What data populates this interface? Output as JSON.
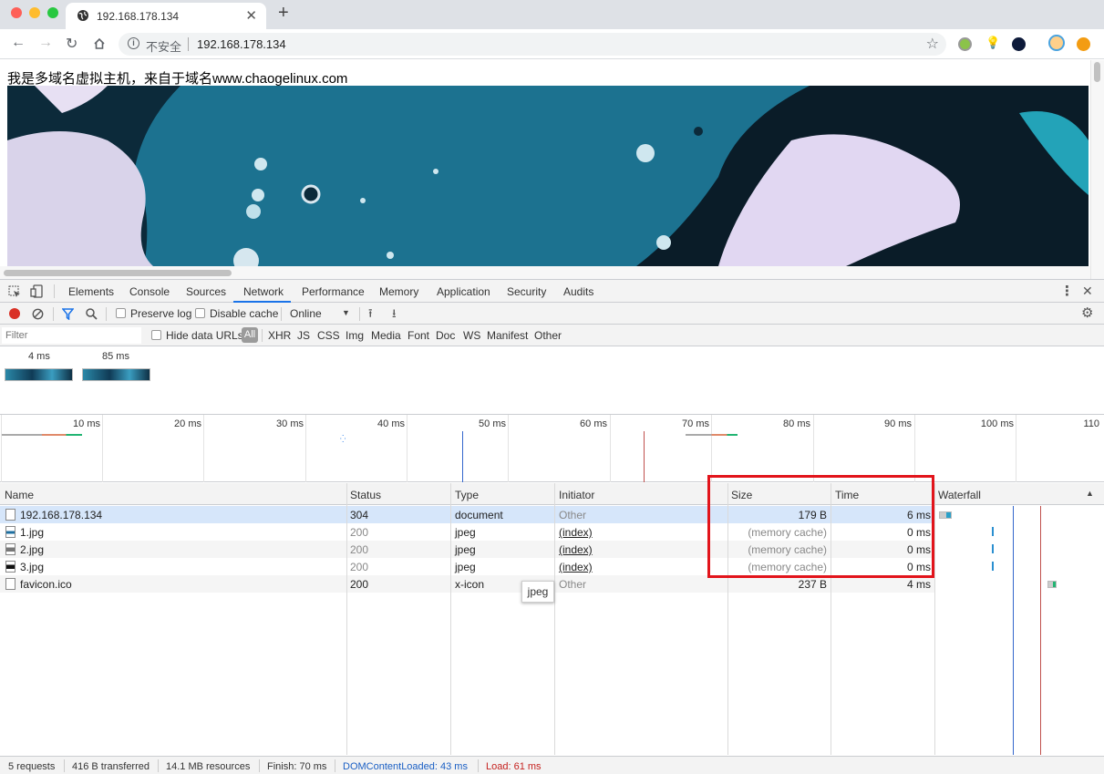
{
  "browser": {
    "tab_title": "192.168.178.134",
    "insecure_label": "不安全",
    "url": "192.168.178.134"
  },
  "page": {
    "text": "我是多域名虚拟主机，来自于域名www.chaogelinux.com"
  },
  "devtools": {
    "tabs": [
      "Elements",
      "Console",
      "Sources",
      "Network",
      "Performance",
      "Memory",
      "Application",
      "Security",
      "Audits"
    ],
    "active_tab": "Network",
    "toolbar": {
      "preserve_log": "Preserve log",
      "disable_cache": "Disable cache",
      "throttle": "Online"
    },
    "filter": {
      "placeholder": "Filter",
      "hide_data_urls": "Hide data URLs",
      "types": [
        "All",
        "XHR",
        "JS",
        "CSS",
        "Img",
        "Media",
        "Font",
        "Doc",
        "WS",
        "Manifest",
        "Other"
      ]
    },
    "screenshots": [
      "4 ms",
      "85 ms"
    ],
    "overview_ticks": [
      "10 ms",
      "20 ms",
      "30 ms",
      "40 ms",
      "50 ms",
      "60 ms",
      "70 ms",
      "80 ms",
      "90 ms",
      "100 ms",
      "110"
    ],
    "columns": [
      "Name",
      "Status",
      "Type",
      "Initiator",
      "Size",
      "Time",
      "Waterfall"
    ],
    "rows": [
      {
        "name": "192.168.178.134",
        "status": "304",
        "type": "document",
        "initiator": "Other",
        "size": "179 B",
        "time": "6 ms"
      },
      {
        "name": "1.jpg",
        "status": "200",
        "type": "jpeg",
        "initiator": "(index)",
        "size": "(memory cache)",
        "time": "0 ms"
      },
      {
        "name": "2.jpg",
        "status": "200",
        "type": "jpeg",
        "initiator": "(index)",
        "size": "(memory cache)",
        "time": "0 ms"
      },
      {
        "name": "3.jpg",
        "status": "200",
        "type": "jpeg",
        "initiator": "(index)",
        "size": "(memory cache)",
        "time": "0 ms"
      },
      {
        "name": "favicon.ico",
        "status": "200",
        "type": "x-icon",
        "initiator": "Other",
        "size": "237 B",
        "time": "4 ms"
      }
    ],
    "tooltip": "jpeg",
    "status": {
      "requests": "5 requests",
      "transferred": "416 B transferred",
      "resources": "14.1 MB resources",
      "finish": "Finish: 70 ms",
      "dom_content_loaded": "DOMContentLoaded: 43 ms",
      "load": "Load: 61 ms"
    }
  }
}
